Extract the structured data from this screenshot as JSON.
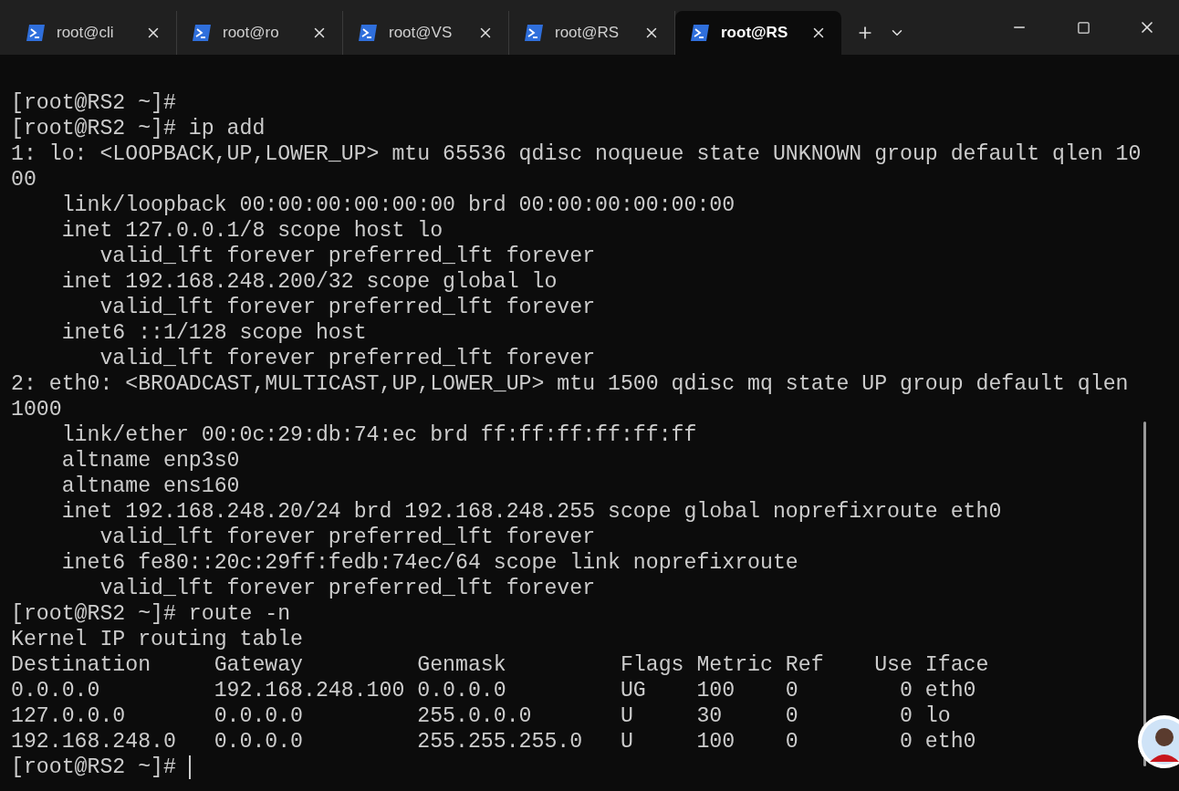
{
  "tabs": [
    {
      "label": "root@cli",
      "selected": false
    },
    {
      "label": "root@ro",
      "selected": false
    },
    {
      "label": "root@VS",
      "selected": false
    },
    {
      "label": "root@RS",
      "selected": false
    },
    {
      "label": "root@RS",
      "selected": true
    }
  ],
  "terminal": {
    "lines": [
      "[root@RS2 ~]#",
      "[root@RS2 ~]# ip add",
      "1: lo: <LOOPBACK,UP,LOWER_UP> mtu 65536 qdisc noqueue state UNKNOWN group default qlen 10",
      "00",
      "    link/loopback 00:00:00:00:00:00 brd 00:00:00:00:00:00",
      "    inet 127.0.0.1/8 scope host lo",
      "       valid_lft forever preferred_lft forever",
      "    inet 192.168.248.200/32 scope global lo",
      "       valid_lft forever preferred_lft forever",
      "    inet6 ::1/128 scope host",
      "       valid_lft forever preferred_lft forever",
      "2: eth0: <BROADCAST,MULTICAST,UP,LOWER_UP> mtu 1500 qdisc mq state UP group default qlen",
      "1000",
      "    link/ether 00:0c:29:db:74:ec brd ff:ff:ff:ff:ff:ff",
      "    altname enp3s0",
      "    altname ens160",
      "    inet 192.168.248.20/24 brd 192.168.248.255 scope global noprefixroute eth0",
      "       valid_lft forever preferred_lft forever",
      "    inet6 fe80::20c:29ff:fedb:74ec/64 scope link noprefixroute",
      "       valid_lft forever preferred_lft forever",
      "[root@RS2 ~]# route -n",
      "Kernel IP routing table",
      "Destination     Gateway         Genmask         Flags Metric Ref    Use Iface",
      "0.0.0.0         192.168.248.100 0.0.0.0         UG    100    0        0 eth0",
      "127.0.0.0       0.0.0.0         255.0.0.0       U     30     0        0 lo",
      "192.168.248.0   0.0.0.0         255.255.255.0   U     100    0        0 eth0"
    ],
    "prompt": "[root@RS2 ~]# "
  }
}
